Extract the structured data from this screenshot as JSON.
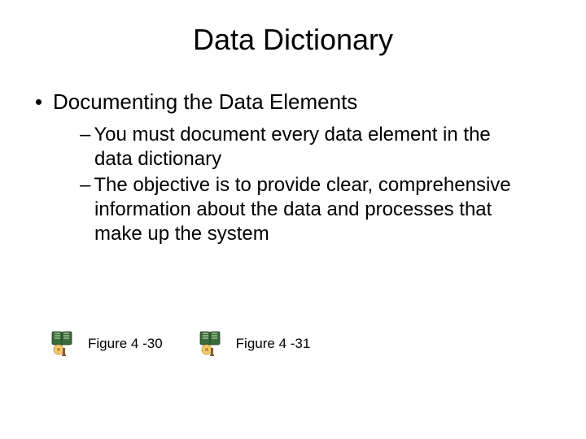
{
  "title": "Data Dictionary",
  "bullet1": "Documenting the Data Elements",
  "sub1": "You must document every data element in the data dictionary",
  "sub2": "The objective is to provide clear, comprehensive information about the data and processes that make up the system",
  "fig1_label": "Figure 4 -30",
  "fig2_label": "Figure 4 -31"
}
